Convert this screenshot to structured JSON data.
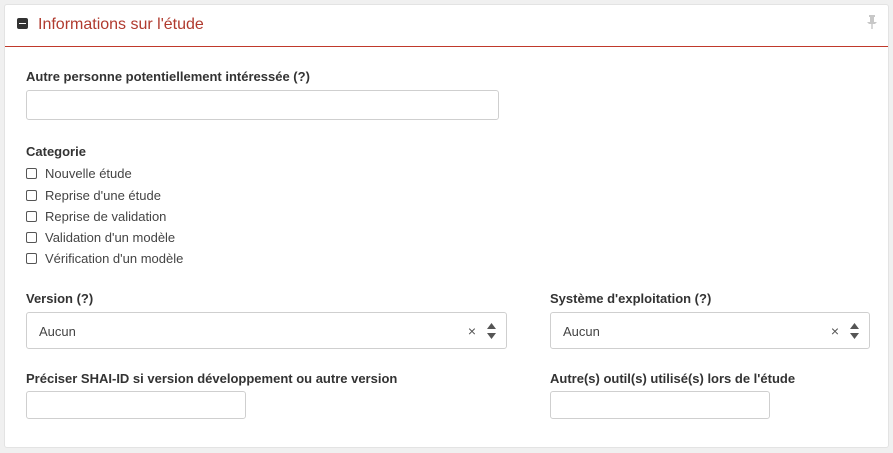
{
  "panel": {
    "title": "Informations sur l'étude",
    "accent_color": "#c0392b"
  },
  "icons": {
    "collapse": "minus-square-icon",
    "pin": "pin-icon",
    "clear": "clear-icon",
    "arrows": "sort-arrows-icon"
  },
  "fields": {
    "other_person": {
      "label": "Autre personne potentiellement intéressée (?)",
      "value": ""
    },
    "category": {
      "label": "Categorie",
      "options": [
        "Nouvelle étude",
        "Reprise d'une étude",
        "Reprise de validation",
        "Validation d'un modèle",
        "Vérification d'un modèle"
      ]
    },
    "version": {
      "label": "Version (?)",
      "selected": "Aucun",
      "clear": "×"
    },
    "os": {
      "label": "Système d'exploitation (?)",
      "selected": "Aucun",
      "clear": "×"
    },
    "shai_id": {
      "label": "Préciser SHAI-ID si version développement ou autre version",
      "value": ""
    },
    "other_tools": {
      "label": "Autre(s) outil(s) utilisé(s) lors de l'étude",
      "value": ""
    }
  }
}
